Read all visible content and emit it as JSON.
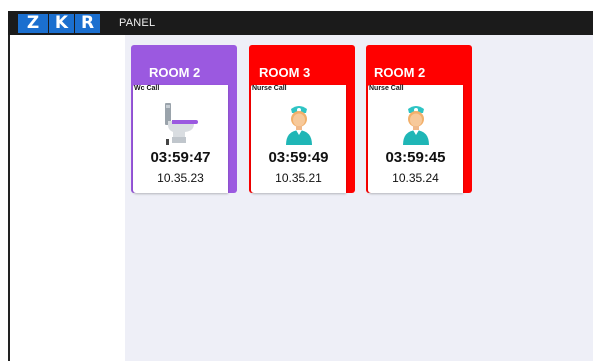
{
  "header": {
    "logo_letters": [
      "Z",
      "K",
      "R"
    ],
    "panel_label": "PANEL",
    "logo_color": "#1b6fcf"
  },
  "cards": [
    {
      "room": "ROOM 2",
      "call_type": "Wc Call",
      "time": "03:59:47",
      "address": "10.35.23",
      "color": "#9b59e0",
      "icon": "toilet-icon"
    },
    {
      "room": "ROOM 3",
      "call_type": "Nurse Call",
      "time": "03:59:49",
      "address": "10.35.21",
      "color": "#ff0000",
      "icon": "nurse-icon"
    },
    {
      "room": "ROOM 2",
      "call_type": "Nurse Call",
      "time": "03:59:45",
      "address": "10.35.24",
      "color": "#ff0000",
      "icon": "nurse-icon"
    }
  ]
}
